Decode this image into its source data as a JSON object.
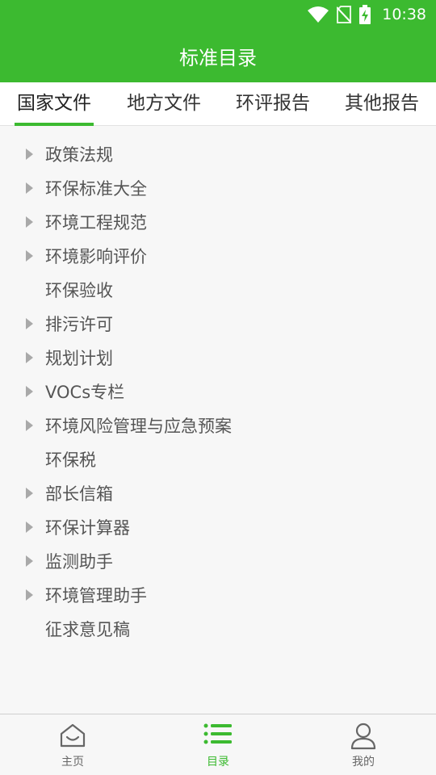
{
  "status_bar": {
    "time": "10:38",
    "icons": [
      "wifi-icon",
      "no-sim-icon",
      "battery-charging-icon"
    ]
  },
  "header": {
    "title": "标准目录"
  },
  "tabs": [
    {
      "label": "国家文件",
      "active": true
    },
    {
      "label": "地方文件",
      "active": false
    },
    {
      "label": "环评报告",
      "active": false
    },
    {
      "label": "其他报告",
      "active": false
    }
  ],
  "list": {
    "items": [
      {
        "label": "政策法规",
        "expandable": true
      },
      {
        "label": "环保标准大全",
        "expandable": true
      },
      {
        "label": "环境工程规范",
        "expandable": true
      },
      {
        "label": "环境影响评价",
        "expandable": true
      },
      {
        "label": "环保验收",
        "expandable": false
      },
      {
        "label": "排污许可",
        "expandable": true
      },
      {
        "label": "规划计划",
        "expandable": true
      },
      {
        "label": "VOCs专栏",
        "expandable": true
      },
      {
        "label": "环境风险管理与应急预案",
        "expandable": true
      },
      {
        "label": "环保税",
        "expandable": false
      },
      {
        "label": "部长信箱",
        "expandable": true
      },
      {
        "label": "环保计算器",
        "expandable": true
      },
      {
        "label": "监测助手",
        "expandable": true
      },
      {
        "label": "环境管理助手",
        "expandable": true
      },
      {
        "label": "征求意见稿",
        "expandable": false
      }
    ]
  },
  "bottom_nav": [
    {
      "label": "主页",
      "icon": "home-icon",
      "active": false
    },
    {
      "label": "目录",
      "icon": "list-icon",
      "active": true
    },
    {
      "label": "我的",
      "icon": "user-icon",
      "active": false
    }
  ],
  "colors": {
    "accent": "#3cba30",
    "text": "#555555",
    "arrow": "#a9a9a9"
  }
}
